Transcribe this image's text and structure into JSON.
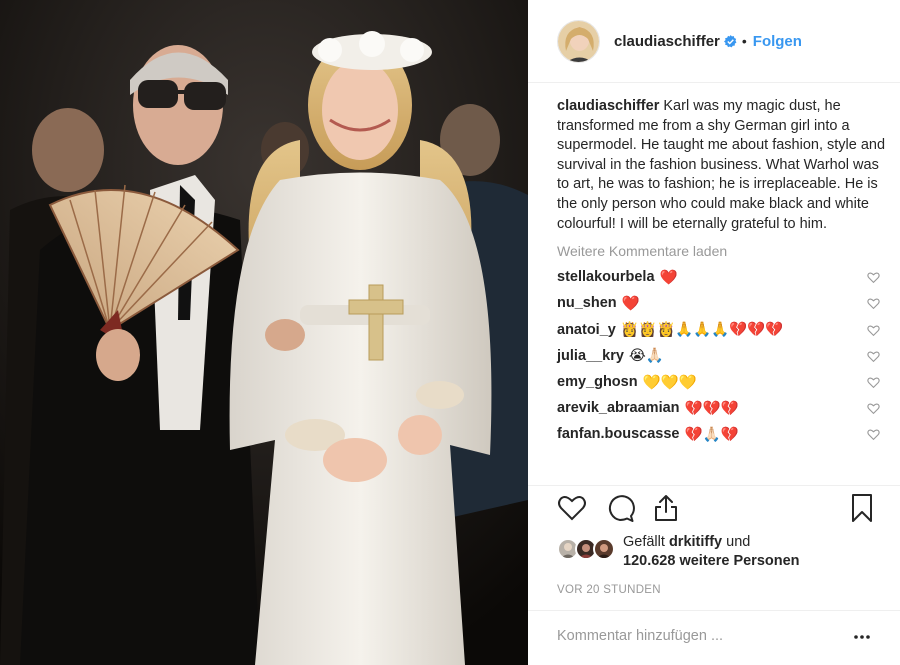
{
  "post": {
    "author": "claudiaschiffer",
    "follow_label": "Folgen",
    "separator": "•",
    "icons": {
      "avatar": "avatar",
      "verified": "verified-badge-icon",
      "like": "heart-outline-icon",
      "comment": "comment-bubble-icon",
      "share": "share-icon",
      "save": "bookmark-icon",
      "more": "more-options-icon"
    },
    "colors": {
      "accent": "#3897f0",
      "text": "#262626",
      "muted": "#999999",
      "border": "#efefef",
      "heart_red": "#ed4956"
    }
  },
  "caption": {
    "author": "claudiaschiffer",
    "text": "Karl was my magic dust, he transformed me from a shy German girl into a supermodel. He taught me about fashion, style and survival in the fashion business. What Warhol was to art, he was to fashion; he is irreplaceable. He is the only person who could make black and white colourful! I will be eternally grateful to him."
  },
  "load_more": "Weitere Kommentare laden",
  "comments": [
    {
      "user": "stellakourbela",
      "text": "❤️"
    },
    {
      "user": "nu_shen",
      "text": "❤️"
    },
    {
      "user": "anatoi_y",
      "text": "👸👸👸🙏🙏🙏💔💔💔"
    },
    {
      "user": "julia__kry",
      "text": "😭🙏🏻"
    },
    {
      "user": "emy_ghosn",
      "text": "💛💛💛"
    },
    {
      "user": "arevik_abraamian",
      "text": "💔💔💔"
    },
    {
      "user": "fanfan.bouscasse",
      "text": "💔🙏🏻💔"
    }
  ],
  "likes": {
    "prefix": "Gefällt",
    "user": "drkitiffy",
    "conj": "und",
    "count_text": "120.628 weitere Personen"
  },
  "timestamp": "VOR 20 STUNDEN",
  "add_comment": {
    "placeholder": "Kommentar hinzufügen ..."
  }
}
